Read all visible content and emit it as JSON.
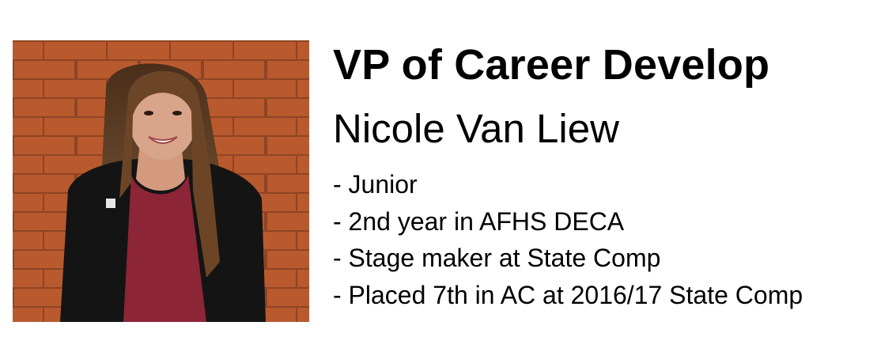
{
  "profile": {
    "photo_icon": "portrait-photo",
    "role_title": "VP of Career Develop",
    "name": "Nicole Van Liew",
    "facts": [
      "- Junior",
      "- 2nd year in AFHS DECA",
      "- Stage maker at State Comp",
      "- Placed 7th in AC at 2016/17 State Comp"
    ]
  },
  "colors": {
    "brick": "#b85a2e",
    "mortar": "#9a4a28",
    "blazer": "#141414",
    "top": "#8c2536",
    "hair": "#5a3a22",
    "skin": "#d9a58a"
  }
}
